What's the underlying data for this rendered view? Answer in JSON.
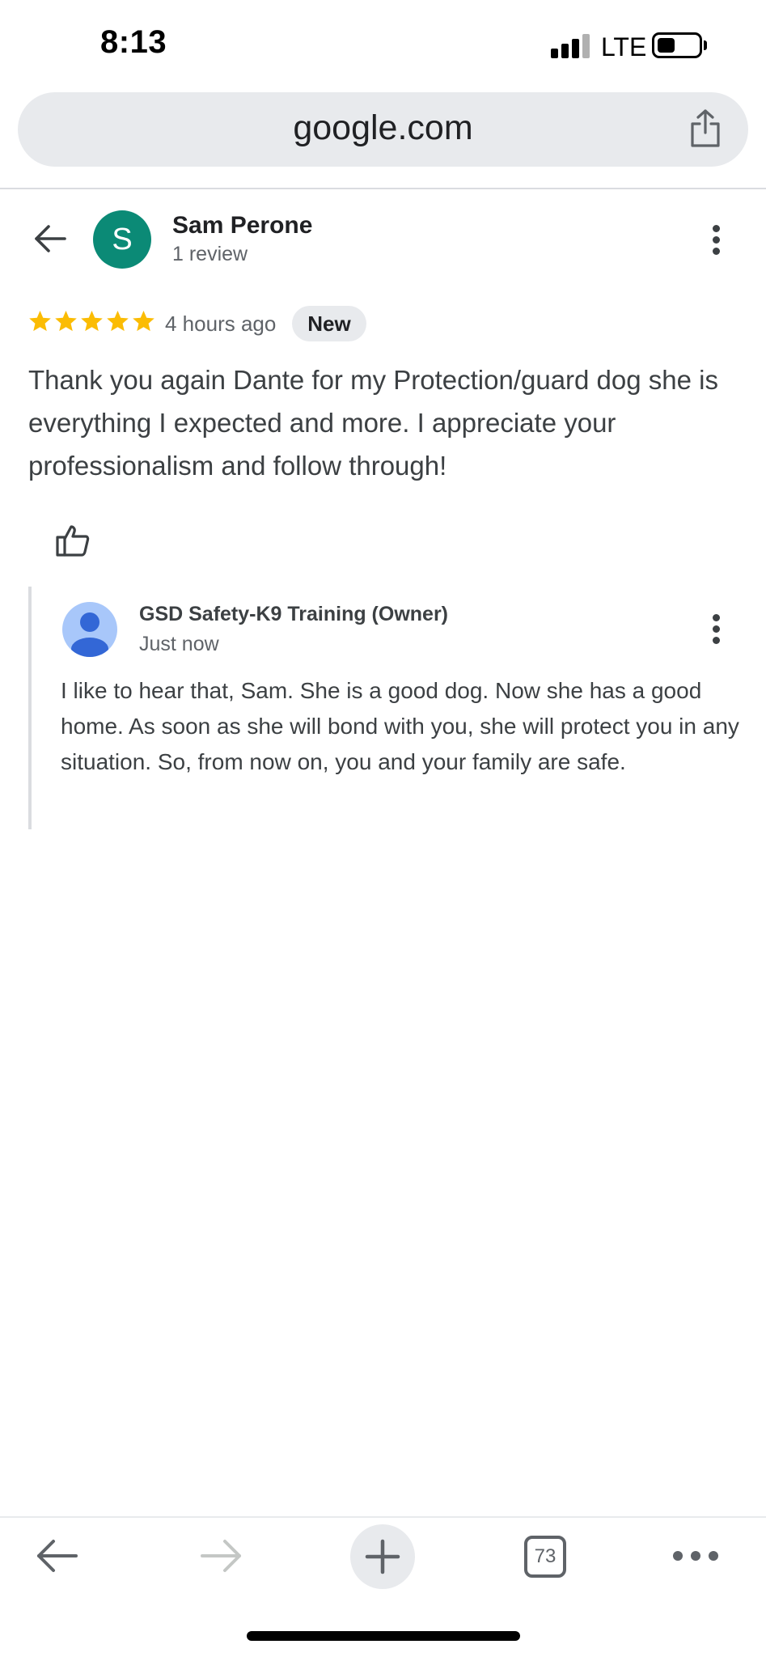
{
  "status_bar": {
    "time": "8:13",
    "network": "LTE"
  },
  "browser": {
    "url": "google.com",
    "tab_count": "73"
  },
  "review": {
    "avatar_letter": "S",
    "avatar_color": "#0b8a76",
    "reviewer_name": "Sam Perone",
    "reviewer_review_count": "1 review",
    "rating": 5,
    "star_color": "#fbbc04",
    "time_ago": "4 hours ago",
    "badge": "New",
    "text": "Thank you again Dante for my Protection/guard dog she is everything I expected and more. I appreciate your professionalism and follow through!"
  },
  "owner_reply": {
    "name": "GSD Safety-K9 Training (Owner)",
    "time": "Just now",
    "text": "I like to hear that, Sam. She is a good dog. Now she has a good home. As soon as she will bond with you, she will protect you in any situation. So, from now on, you and your family are safe."
  },
  "icons": {
    "back": "arrow-left-icon",
    "share": "share-icon",
    "more": "more-vertical-icon",
    "like": "thumbs-up-icon",
    "toolbar_back": "arrow-left-icon",
    "toolbar_forward": "arrow-right-icon",
    "new_tab": "plus-icon",
    "tabs": "tab-switcher-icon",
    "menu": "more-horizontal-icon"
  }
}
